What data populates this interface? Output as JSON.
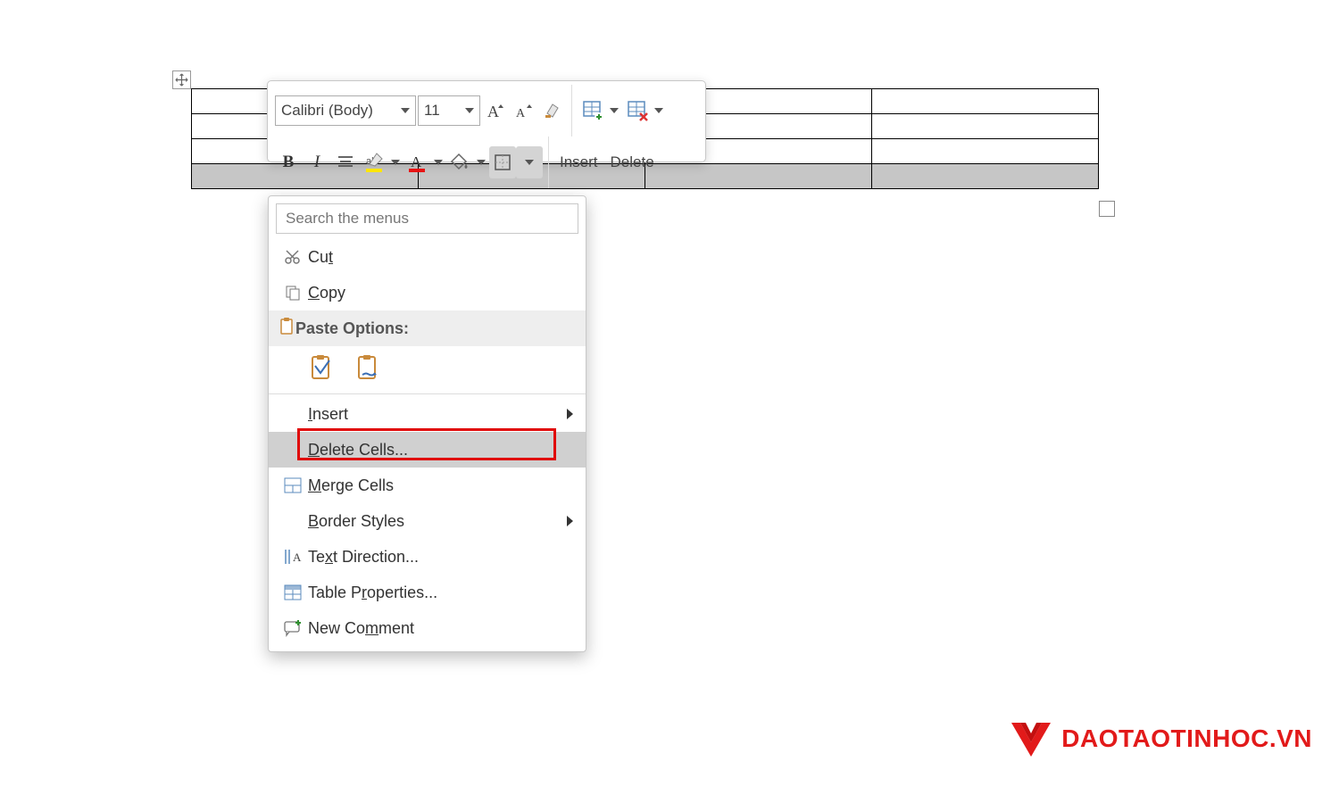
{
  "mini_toolbar": {
    "font_name": "Calibri (Body)",
    "font_size": "11",
    "insert_label": "Insert",
    "delete_label": "Delete"
  },
  "context_menu": {
    "search_placeholder": "Search the menus",
    "cut": "Cut",
    "copy": "Copy",
    "paste_options": "Paste Options:",
    "insert": "Insert",
    "delete_cells": "Delete Cells...",
    "merge_cells": "Merge Cells",
    "border_styles": "Border Styles",
    "text_direction": "Text Direction...",
    "table_properties": "Table Properties...",
    "new_comment": "New Comment"
  },
  "watermark": "DAOTAOTINHOC.VN"
}
